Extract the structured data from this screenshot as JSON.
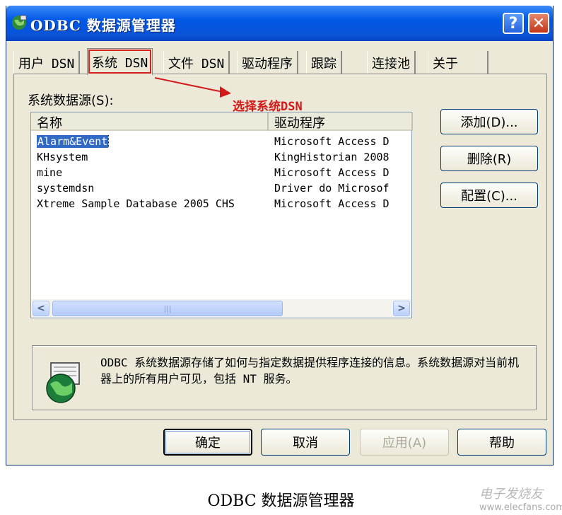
{
  "window": {
    "title": "ODBC 数据源管理器",
    "help_glyph": "?",
    "close_glyph": "✕"
  },
  "tabs": [
    {
      "label": "用户 DSN",
      "active": false
    },
    {
      "label": "系统 DSN",
      "active": true
    },
    {
      "label": "文件 DSN",
      "active": false
    },
    {
      "label": "驱动程序",
      "active": false
    },
    {
      "label": "跟踪",
      "active": false
    },
    {
      "label": "连接池",
      "active": false
    },
    {
      "label": "关于",
      "active": false
    }
  ],
  "section_label": "系统数据源(S):",
  "annotation": {
    "text": "选择系统DSN",
    "color": "#d21a1a"
  },
  "list": {
    "columns": [
      "名称",
      "驱动程序"
    ],
    "rows": [
      {
        "name": "Alarm&Event",
        "driver": "Microsoft Access D",
        "selected": true
      },
      {
        "name": "KHsystem",
        "driver": "KingHistorian 2008",
        "selected": false
      },
      {
        "name": "mine",
        "driver": "Microsoft Access D",
        "selected": false
      },
      {
        "name": "systemdsn",
        "driver": "Driver do Microsof",
        "selected": false
      },
      {
        "name": "Xtreme Sample Database 2005 CHS",
        "driver": "Microsoft Access D",
        "selected": false
      }
    ],
    "scroll_left": "<",
    "scroll_right": ">",
    "scroll_thumb": "|||"
  },
  "side_buttons": {
    "add": "添加(D)...",
    "remove": "删除(R)",
    "configure": "配置(C)..."
  },
  "info_text": "ODBC 系统数据源存储了如何与指定数据提供程序连接的信息。系统数据源对当前机器上的所有用户可见，包括 NT 服务。",
  "bottom_buttons": {
    "ok": "确定",
    "cancel": "取消",
    "apply": "应用(A)",
    "help": "帮助"
  },
  "caption": "ODBC 数据源管理器",
  "watermark": {
    "main": "电子发烧友",
    "sub": "www.elecfans.com"
  },
  "colors": {
    "titlebar": "#0058e6",
    "selection": "#316ac5",
    "annotation": "#d21a1a"
  }
}
